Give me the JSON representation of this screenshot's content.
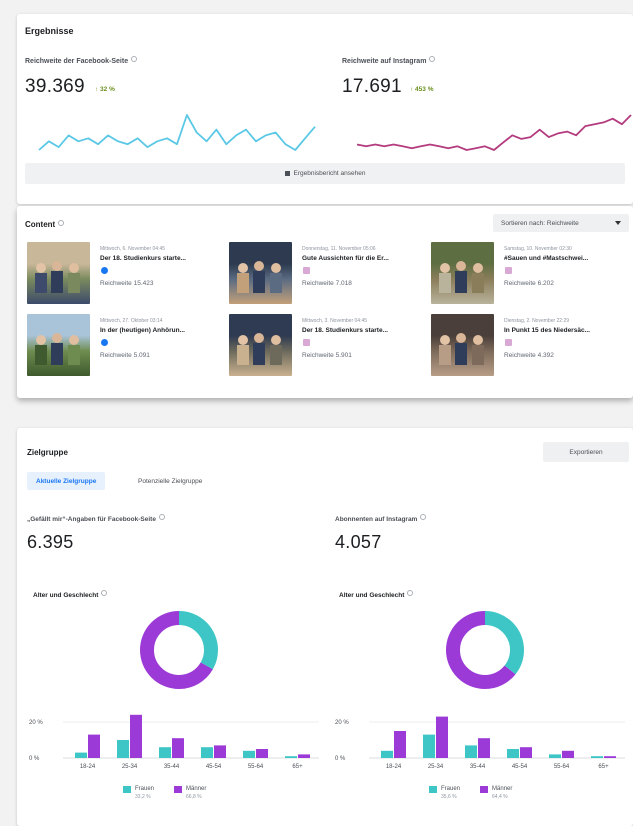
{
  "results": {
    "title": "Ergebnisse",
    "facebook": {
      "label": "Reichweite der Facebook-Seite",
      "value": "39.369",
      "delta": "↑ 32 %",
      "line_color": "#5bc8e6",
      "trend": [
        5,
        8,
        6,
        10,
        8,
        9,
        7,
        10,
        8,
        7,
        9,
        6,
        8,
        9,
        7,
        17,
        11,
        8,
        12,
        7,
        10,
        12,
        8,
        10,
        11,
        7,
        5,
        9,
        13
      ]
    },
    "instagram": {
      "label": "Reichweite auf Instagram",
      "value": "17.691",
      "delta": "↑ 453 %",
      "line_color": "#b33b7e",
      "trend": [
        8,
        7,
        8,
        7,
        8,
        7,
        6,
        7,
        8,
        7,
        6,
        7,
        5,
        6,
        7,
        5,
        9,
        13,
        11,
        12,
        16,
        12,
        14,
        15,
        13,
        18,
        19,
        20,
        22,
        19,
        24
      ]
    },
    "report_button": "Ergebnisbericht ansehen"
  },
  "content": {
    "title": "Content",
    "sort_label": "Sortieren nach: Reichweite",
    "posts": [
      {
        "date": "Mittwoch, 6. November 04:45",
        "title": "Der 18. Studienkurs starte...",
        "platform": "facebook",
        "reach": "Reichweite  15.423"
      },
      {
        "date": "Donnerstag, 11. November 05:06",
        "title": "Gute Aussichten für die Er...",
        "platform": "instagram",
        "reach": "Reichweite  7.018"
      },
      {
        "date": "Samstag, 10. November 02:30",
        "title": "#Sauen und #Mastschwei...",
        "platform": "instagram",
        "reach": "Reichweite  6.202"
      },
      {
        "date": "Mittwoch, 27. Oktober 03:14",
        "title": "In der (heutigen) Anhörun...",
        "platform": "facebook",
        "reach": "Reichweite  5.091"
      },
      {
        "date": "Mittwoch, 3. November 04:45",
        "title": "Der 18. Studienkurs starte...",
        "platform": "instagram",
        "reach": "Reichweite  5.901"
      },
      {
        "date": "Dienstag, 2. November 22:29",
        "title": "In Punkt 15 des Niedersäc...",
        "platform": "instagram",
        "reach": "Reichweite  4.392"
      }
    ]
  },
  "audience": {
    "title": "Zielgruppe",
    "export_button": "Exportieren",
    "tabs": [
      "Aktuelle Zielgruppe",
      "Potenzielle Zielgruppe"
    ],
    "facebook_likes_label": "„Gefällt mir“-Angaben für Facebook-Seite",
    "facebook_likes_value": "6.395",
    "instagram_followers_label": "Abonnenten auf Instagram",
    "instagram_followers_value": "4.057",
    "colors": {
      "women": "#3ec6c6",
      "men": "#9b3ad6"
    },
    "left": {
      "title": "Alter und Geschlecht",
      "women_share": 0.332,
      "y_tick_top": "20 %",
      "y_tick_zero": "0 %",
      "age_groups": [
        "18-24",
        "25-34",
        "35-44",
        "45-54",
        "55-64",
        "65+"
      ],
      "women": [
        3,
        10,
        6,
        6,
        4,
        1
      ],
      "men": [
        13,
        24,
        11,
        7,
        5,
        2
      ],
      "legend_women": "Frauen",
      "legend_men": "Männer",
      "women_pct": "33,2 %",
      "men_pct": "66,8 %"
    },
    "right": {
      "title": "Alter und Geschlecht",
      "women_share": 0.356,
      "y_tick_top": "20 %",
      "y_tick_zero": "0 %",
      "age_groups": [
        "18-24",
        "25-34",
        "35-44",
        "45-54",
        "55-64",
        "65+"
      ],
      "women": [
        4,
        13,
        7,
        5,
        2,
        1
      ],
      "men": [
        15,
        23,
        11,
        6,
        4,
        1
      ],
      "legend_women": "Frauen",
      "legend_men": "Männer",
      "women_pct": "35,6 %",
      "men_pct": "64,4 %"
    }
  }
}
